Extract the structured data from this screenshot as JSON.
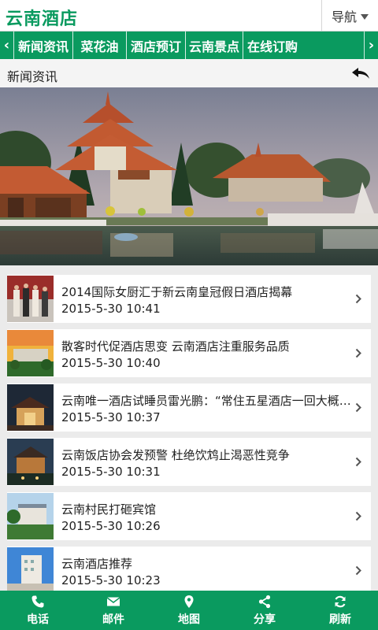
{
  "header": {
    "logo": "云南酒店",
    "nav_label": "导航"
  },
  "categories": [
    "新闻资讯",
    "菜花油",
    "酒店预订",
    "云南景点",
    "在线订购"
  ],
  "section": {
    "title": "新闻资讯"
  },
  "news": [
    {
      "title": "2014国际女厨汇于新云南皇冠假日酒店揭幕",
      "date": "2015-5-30 10:41"
    },
    {
      "title": "散客时代促酒店思变 云南酒店注重服务品质",
      "date": "2015-5-30 10:40"
    },
    {
      "title": "云南唯一酒店试睡员雷光鹏：“常住五星酒店一回大概要花费多少钱”",
      "date": "2015-5-30 10:37"
    },
    {
      "title": "云南饭店协会发预警 杜绝饮鸩止渴恶性竞争",
      "date": "2015-5-30 10:31"
    },
    {
      "title": "云南村民打砸宾馆",
      "date": "2015-5-30 10:26"
    },
    {
      "title": "云南酒店推荐",
      "date": "2015-5-30 10:23"
    }
  ],
  "bottom_nav": [
    {
      "label": "电话",
      "icon": "phone-icon"
    },
    {
      "label": "邮件",
      "icon": "mail-icon"
    },
    {
      "label": "地图",
      "icon": "map-pin-icon"
    },
    {
      "label": "分享",
      "icon": "share-icon"
    },
    {
      "label": "刷新",
      "icon": "refresh-icon"
    }
  ],
  "colors": {
    "brand_green": "#0a9a5f",
    "background": "#ebebeb"
  }
}
